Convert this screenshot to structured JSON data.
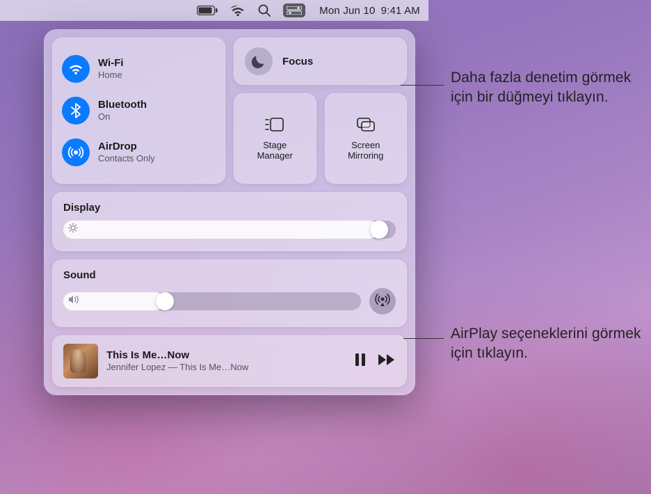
{
  "menubar": {
    "date": "Mon Jun 10",
    "time": "9:41 AM"
  },
  "connectivity": {
    "wifi": {
      "title": "Wi-Fi",
      "sub": "Home"
    },
    "bluetooth": {
      "title": "Bluetooth",
      "sub": "On"
    },
    "airdrop": {
      "title": "AirDrop",
      "sub": "Contacts Only"
    }
  },
  "focus": {
    "label": "Focus"
  },
  "stage_manager": {
    "label": "Stage\nManager"
  },
  "screen_mirroring": {
    "label": "Screen\nMirroring"
  },
  "display": {
    "title": "Display",
    "brightness_percent": 95
  },
  "sound": {
    "title": "Sound",
    "volume_percent": 34
  },
  "now_playing": {
    "title": "This Is Me…Now",
    "subtitle": "Jennifer Lopez — This Is Me…Now"
  },
  "callouts": {
    "focus": "Daha fazla denetim görmek için bir düğmeyi tıklayın.",
    "airplay": "AirPlay seçeneklerini görmek için tıklayın."
  },
  "colors": {
    "accent_blue": "#0a7aff"
  }
}
